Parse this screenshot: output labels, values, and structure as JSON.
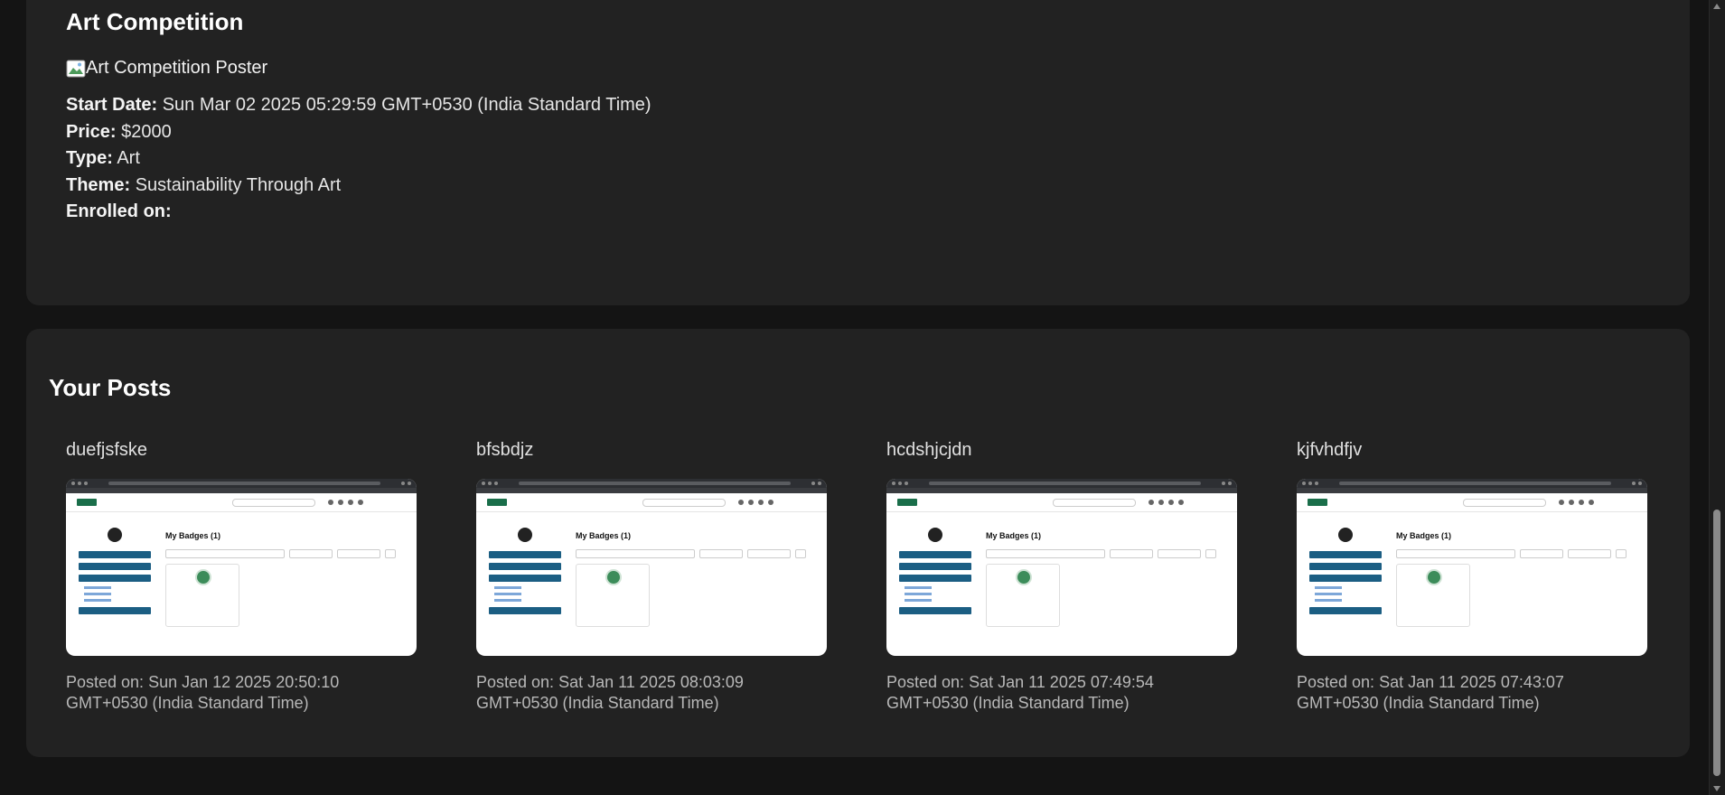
{
  "competition": {
    "title": "Art Competition",
    "poster_alt": "Art Competition Poster",
    "fields": [
      {
        "label": "Start Date:",
        "value": "Sun Mar 02 2025 05:29:59 GMT+0530 (India Standard Time)"
      },
      {
        "label": "Price:",
        "value": "$2000"
      },
      {
        "label": "Type:",
        "value": "Art"
      },
      {
        "label": "Theme:",
        "value": "Sustainability Through Art"
      },
      {
        "label": "Enrolled on:",
        "value": ""
      }
    ]
  },
  "posts_section": {
    "title": "Your Posts",
    "posts": [
      {
        "title": "duefjsfske",
        "posted_label": "Posted on:",
        "posted_on": "Sun Jan 12 2025 20:50:10 GMT+0530 (India Standard Time)",
        "thumb_heading": "My Badges (1)"
      },
      {
        "title": "bfsbdjz",
        "posted_label": "Posted on:",
        "posted_on": "Sat Jan 11 2025 08:03:09 GMT+0530 (India Standard Time)",
        "thumb_heading": "My Badges (1)"
      },
      {
        "title": "hcdshjcjdn",
        "posted_label": "Posted on:",
        "posted_on": "Sat Jan 11 2025 07:49:54 GMT+0530 (India Standard Time)",
        "thumb_heading": "My Badges (1)"
      },
      {
        "title": "kjfvhdfjv",
        "posted_label": "Posted on:",
        "posted_on": "Sat Jan 11 2025 07:43:07 GMT+0530 (India Standard Time)",
        "thumb_heading": "My Badges (1)"
      }
    ]
  },
  "colors": {
    "page_bg": "#141414",
    "card_bg": "#222222",
    "text": "#e6e6e6",
    "muted": "#b8b8b8"
  }
}
